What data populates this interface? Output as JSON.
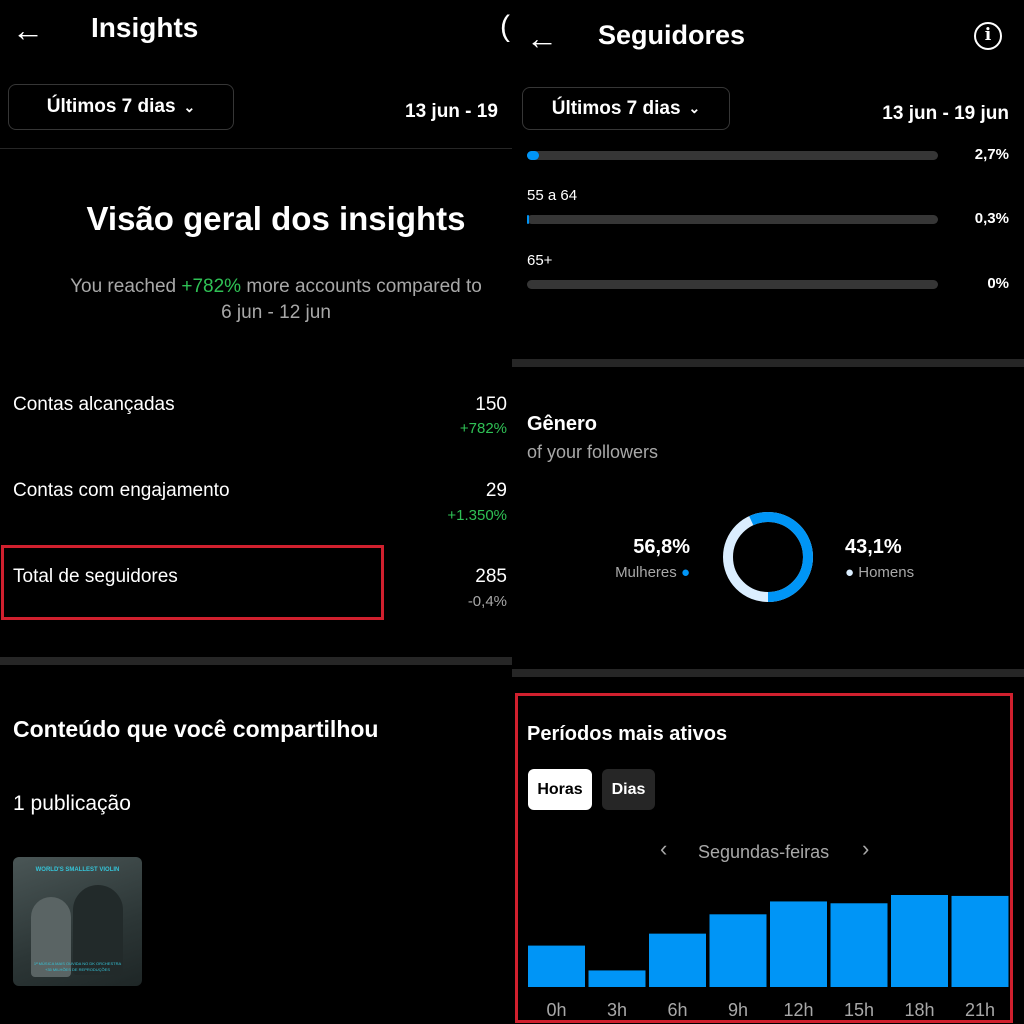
{
  "left": {
    "title": "Insights",
    "period_label": "Últimos 7 dias",
    "date_range": "13 jun - 19",
    "overview_title": "Visão geral dos insights",
    "reach_prefix": "You reached ",
    "reach_pct": "+782%",
    "reach_suffix": " more accounts compared to",
    "reach_compare": "6 jun - 12 jun",
    "metrics": [
      {
        "label": "Contas alcançadas",
        "value": "150",
        "change": "+782%",
        "color": "#2fc155"
      },
      {
        "label": "Contas com engajamento",
        "value": "29",
        "change": "+1.350%",
        "color": "#2fc155"
      },
      {
        "label": "Total de seguidores",
        "value": "285",
        "change": "-0,4%",
        "color": "#a8a8a8"
      }
    ],
    "content_title": "Conteúdo que você compartilhou",
    "content_count": "1 publicação",
    "thumbnail": {
      "heading": "WORLD'S SMALLEST VIOLIN",
      "caption1": "1ª MÚSICA MAIS OUVIDA NO DK ORCHESTRA",
      "caption2": "+35 MILHÕES DE REPRODUÇÕES"
    }
  },
  "right": {
    "title": "Seguidores",
    "period_label": "Últimos 7 dias",
    "date_range": "13 jun - 19 jun",
    "age_rows": [
      {
        "label": "",
        "percent": "2,7%",
        "value": 2.7
      },
      {
        "label": "55 a 64",
        "percent": "0,3%",
        "value": 0.3
      },
      {
        "label": "65+",
        "percent": "0%",
        "value": 0
      }
    ],
    "gender_title": "Gênero",
    "gender_subtitle": "of your followers",
    "women_pct": "56,8%",
    "women_label": "Mulheres",
    "men_pct": "43,1%",
    "men_label": "Homens",
    "colors": {
      "women": "#0095f6",
      "men": "#dbeeff",
      "accent": "#0095f6",
      "highlight": "#d0202e"
    },
    "active_title": "Períodos mais ativos",
    "tabs": [
      "Horas",
      "Dias"
    ],
    "day_label": "Segundas-feiras"
  },
  "chart_data": {
    "type": "bar",
    "categories": [
      "0h",
      "3h",
      "6h",
      "9h",
      "12h",
      "15h",
      "18h",
      "21h"
    ],
    "values": [
      45,
      18,
      58,
      79,
      93,
      91,
      100,
      99
    ],
    "title": "",
    "xlabel": "",
    "ylabel": "",
    "ylim": [
      0,
      100
    ]
  }
}
